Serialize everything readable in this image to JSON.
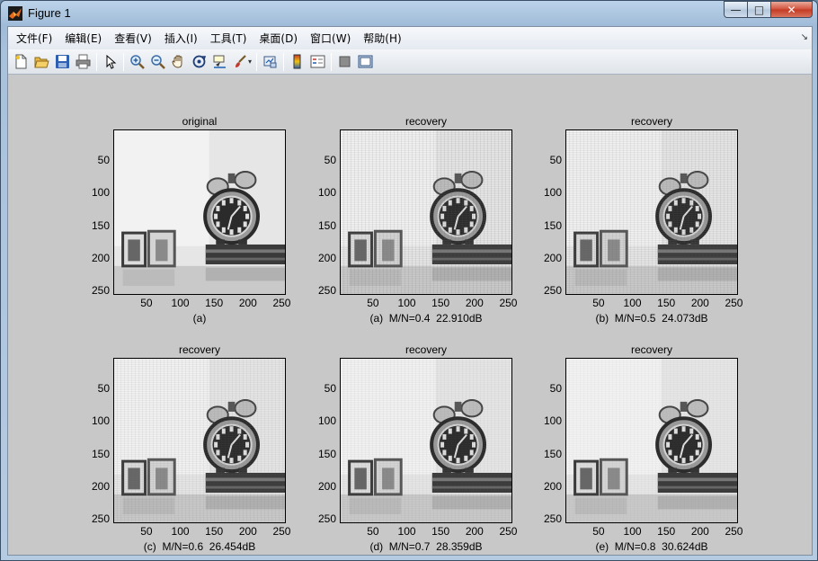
{
  "window": {
    "title": "Figure 1",
    "buttons": {
      "minimize": "—",
      "maximize": "□",
      "close": "✕"
    }
  },
  "menu": {
    "items": [
      "文件(F)",
      "编辑(E)",
      "查看(V)",
      "插入(I)",
      "工具(T)",
      "桌面(D)",
      "窗口(W)",
      "帮助(H)"
    ],
    "overflow_arrow": "↘"
  },
  "toolbar": {
    "icons": [
      "new-figure-icon",
      "open-file-icon",
      "save-icon",
      "print-icon",
      "edit-plot-icon",
      "zoom-in-icon",
      "zoom-out-icon",
      "pan-icon",
      "rotate-3d-icon",
      "data-cursor-icon",
      "brush-icon",
      "link-plot-icon",
      "colorbar-icon",
      "legend-icon",
      "hide-plot-tools-icon",
      "show-plot-tools-icon"
    ],
    "caret": "▾"
  },
  "subplots": [
    {
      "title": "original",
      "xlabel": "(a)",
      "quality": 1.0
    },
    {
      "title": "recovery",
      "xlabel": "(a)  M/N=0.4  22.910dB",
      "quality": 0.4
    },
    {
      "title": "recovery",
      "xlabel": "(b)  M/N=0.5  24.073dB",
      "quality": 0.5
    },
    {
      "title": "recovery",
      "xlabel": "(c)  M/N=0.6  26.454dB",
      "quality": 0.6
    },
    {
      "title": "recovery",
      "xlabel": "(d)  M/N=0.7  28.359dB",
      "quality": 0.7
    },
    {
      "title": "recovery",
      "xlabel": "(e)  M/N=0.8  30.624dB",
      "quality": 0.8
    }
  ],
  "axes": {
    "yticks": [
      "50",
      "100",
      "150",
      "200",
      "250"
    ],
    "xticks": [
      "50",
      "100",
      "150",
      "200",
      "250"
    ],
    "range": [
      1,
      256
    ]
  }
}
